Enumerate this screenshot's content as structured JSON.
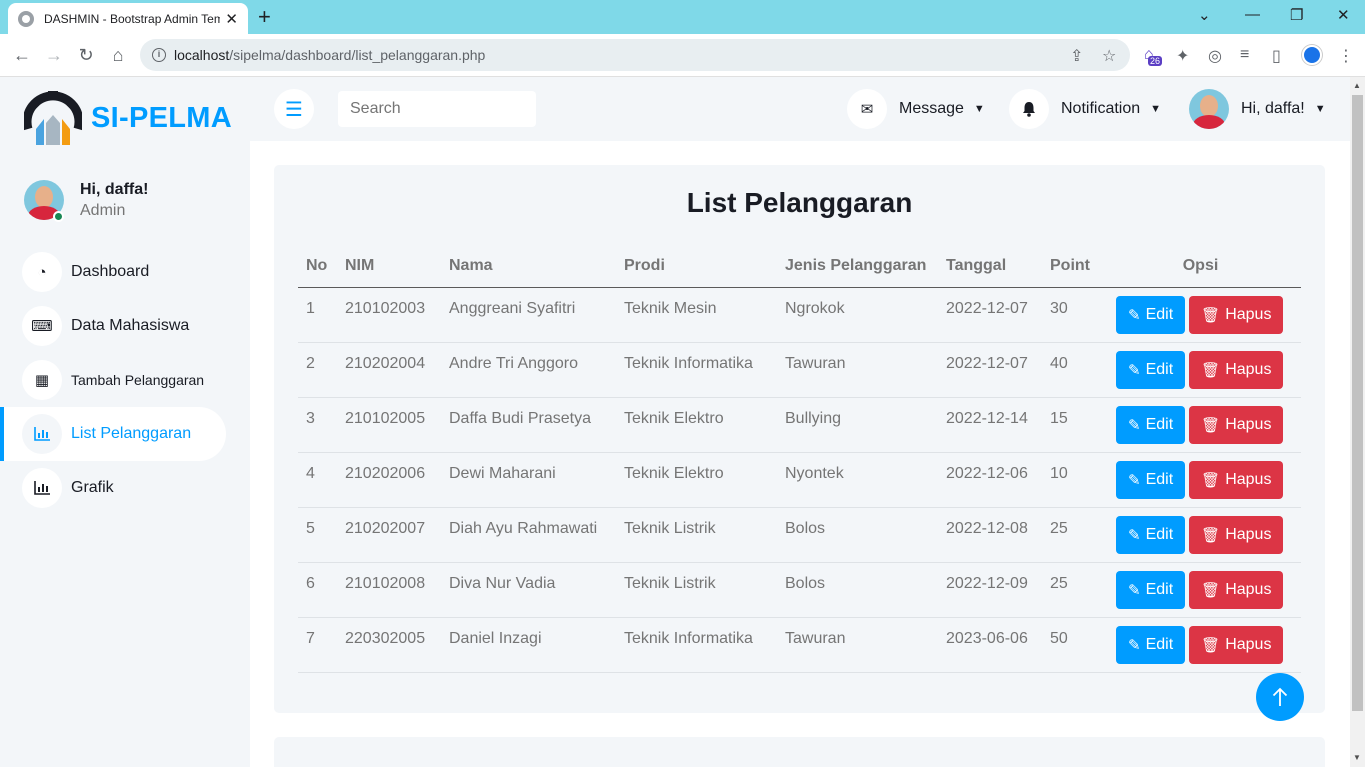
{
  "browser": {
    "tab_title": "DASHMIN - Bootstrap Admin Template",
    "tab_close": "✕",
    "new_tab": "+",
    "url_host": "localhost",
    "url_path": "/sipelma/dashboard/list_pelanggaran.php",
    "ext_badge": "26"
  },
  "brand": {
    "name": "SI-PELMA"
  },
  "user": {
    "greeting": "Hi, daffa!",
    "role": "Admin"
  },
  "sidebar": {
    "items": [
      {
        "label": "Dashboard",
        "icon": "dashboard-icon"
      },
      {
        "label": "Data Mahasiswa",
        "icon": "keyboard-icon"
      },
      {
        "label": "Tambah Pelanggaran",
        "icon": "table-icon"
      },
      {
        "label": "List Pelanggaran",
        "icon": "chart-icon",
        "active": true
      },
      {
        "label": "Grafik",
        "icon": "chart-icon"
      }
    ]
  },
  "topnav": {
    "search_placeholder": "Search",
    "message_label": "Message",
    "notification_label": "Notification",
    "profile_label": "Hi, daffa!"
  },
  "page": {
    "title": "List Pelanggaran",
    "columns": [
      "No",
      "NIM",
      "Nama",
      "Prodi",
      "Jenis Pelanggaran",
      "Tanggal",
      "Point",
      "Opsi"
    ],
    "edit_label": "Edit",
    "delete_label": "Hapus",
    "rows": [
      [
        "1",
        "210102003",
        "Anggreani Syafitri",
        "Teknik Mesin",
        "Ngrokok",
        "2022-12-07",
        "30"
      ],
      [
        "2",
        "210202004",
        "Andre Tri Anggoro",
        "Teknik Informatika",
        "Tawuran",
        "2022-12-07",
        "40"
      ],
      [
        "3",
        "210102005",
        "Daffa Budi Prasetya",
        "Teknik Elektro",
        "Bullying",
        "2022-12-14",
        "15"
      ],
      [
        "4",
        "210202006",
        "Dewi Maharani",
        "Teknik Elektro",
        "Nyontek",
        "2022-12-06",
        "10"
      ],
      [
        "5",
        "210202007",
        "Diah Ayu Rahmawati",
        "Teknik Listrik",
        "Bolos",
        "2022-12-08",
        "25"
      ],
      [
        "6",
        "210102008",
        "Diva Nur Vadia",
        "Teknik Listrik",
        "Bolos",
        "2022-12-09",
        "25"
      ],
      [
        "7",
        "220302005",
        "Daniel Inzagi",
        "Teknik Informatika",
        "Tawuran",
        "2023-06-06",
        "50"
      ]
    ]
  },
  "colors": {
    "primary": "#009cff",
    "danger": "#dc3545",
    "light": "#f3f6f9",
    "dark": "#191c24"
  }
}
